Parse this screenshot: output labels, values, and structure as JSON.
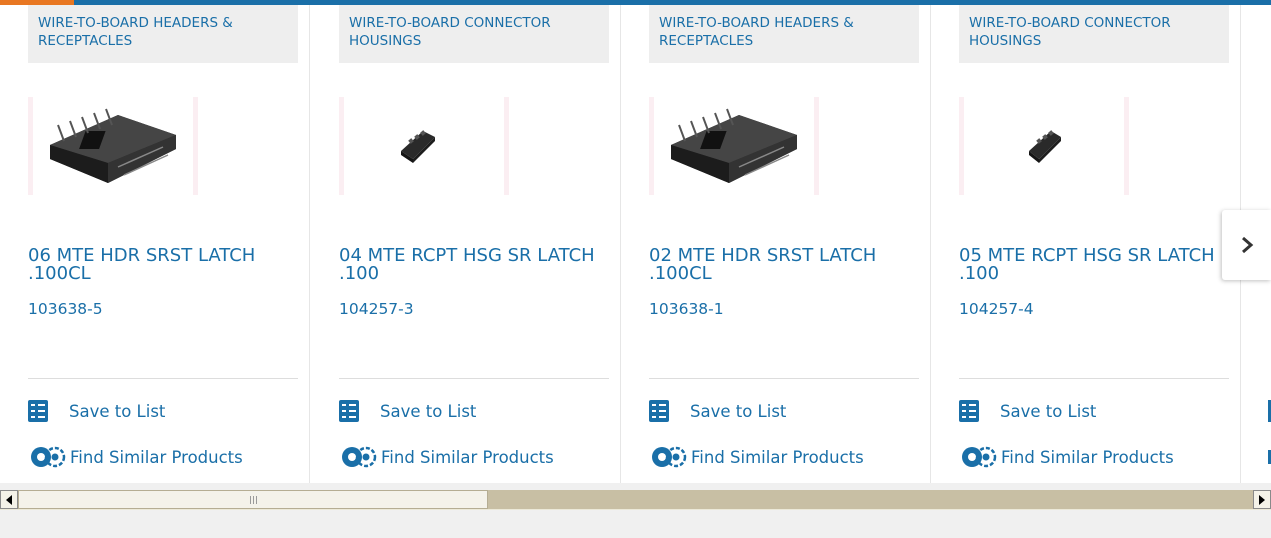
{
  "colors": {
    "accent": "#1a6fa8",
    "brand_orange": "#e87722"
  },
  "products": [
    {
      "category": "WIRE-TO-BOARD HEADERS & RECEPTACLES",
      "title": "06 MTE HDR SRST LATCH .100CL",
      "part": "103638-5",
      "image": "header-connector",
      "save_label": "Save to List",
      "similar_label": "Find Similar Products"
    },
    {
      "category": "WIRE-TO-BOARD CONNECTOR HOUSINGS",
      "title": "04 MTE RCPT HSG SR LATCH .100",
      "part": "104257-3",
      "image": "receptacle-housing",
      "save_label": "Save to List",
      "similar_label": "Find Similar Products"
    },
    {
      "category": "WIRE-TO-BOARD HEADERS & RECEPTACLES",
      "title": "02 MTE HDR SRST LATCH .100CL",
      "part": "103638-1",
      "image": "header-connector",
      "save_label": "Save to List",
      "similar_label": "Find Similar Products"
    },
    {
      "category": "WIRE-TO-BOARD CONNECTOR HOUSINGS",
      "title": "05 MTE RCPT HSG SR LATCH .100",
      "part": "104257-4",
      "image": "receptacle-housing",
      "save_label": "Save to List",
      "similar_label": "Find Similar Products"
    }
  ],
  "carousel": {
    "next_icon": "chevron-right-icon"
  },
  "scrollbar": {
    "left_icon": "arrow-left-icon",
    "right_icon": "arrow-right-icon"
  }
}
